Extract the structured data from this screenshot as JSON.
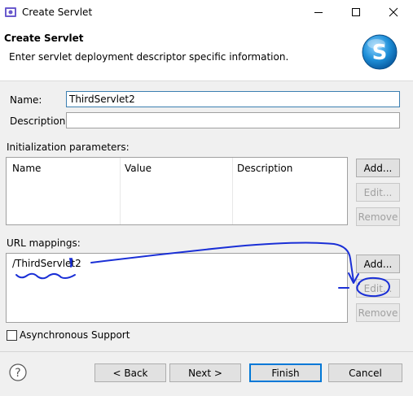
{
  "window": {
    "title": "Create Servlet",
    "controls": {
      "minimize": "minimize-icon",
      "maximize": "maximize-icon",
      "close": "close-icon"
    }
  },
  "banner": {
    "title": "Create Servlet",
    "description": "Enter servlet deployment descriptor specific information.",
    "logo_letter": "S",
    "accent_color": "#1e8fd8"
  },
  "form": {
    "name_label": "Name:",
    "name_value": "ThirdServlet2",
    "description_label": "Description:",
    "description_value": ""
  },
  "init_params": {
    "label": "Initialization parameters:",
    "columns": [
      "Name",
      "Value",
      "Description"
    ],
    "rows": [],
    "buttons": {
      "add": "Add...",
      "edit": "Edit...",
      "remove": "Remove"
    }
  },
  "url_mappings": {
    "label": "URL mappings:",
    "items": [
      "/ThirdServlet2"
    ],
    "buttons": {
      "add": "Add...",
      "edit": "Edit...",
      "remove": "Remove"
    }
  },
  "async": {
    "label": "Asynchronous Support",
    "checked": false
  },
  "footer": {
    "help_icon": "help-icon",
    "back": "< Back",
    "next": "Next >",
    "finish": "Finish",
    "cancel": "Cancel"
  },
  "annotation": {
    "color": "#1a2fd6"
  }
}
